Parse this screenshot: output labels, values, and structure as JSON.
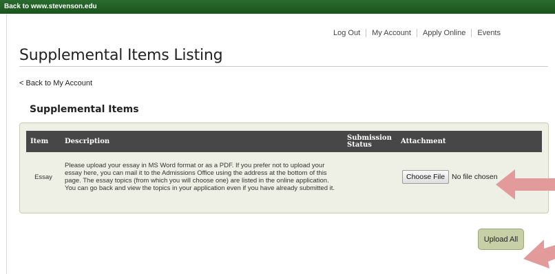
{
  "topbar": {
    "back_link": "Back to www.stevenson.edu"
  },
  "nav": {
    "logout": "Log Out",
    "my_account": "My Account",
    "apply_online": "Apply Online",
    "events": "Events"
  },
  "page": {
    "title": "Supplemental Items Listing",
    "back_link": "< Back to My Account",
    "section_title": "Supplemental Items"
  },
  "table": {
    "headers": {
      "item": "Item",
      "description": "Description",
      "status": "Submission Status",
      "attachment": "Attachment"
    },
    "rows": [
      {
        "item": "Essay",
        "description": "Please upload your essay in MS Word format or as a PDF. If you prefer not to upload your essay here, you can mail it to the Admissions Office using the address at the bottom of this page. The essay topics (from which you will choose one) are listed in the online application. You can go back and view the topics in your application even if you have already submitted it.",
        "status": "",
        "choose_file_label": "Choose File",
        "file_status": "No file chosen"
      }
    ]
  },
  "upload_button": {
    "label": "Upload All"
  },
  "colors": {
    "topbar": "#1b5e20",
    "table_header": "#474747",
    "panel_bg": "#eef0e6",
    "button_bg": "#c6cfa5",
    "annotation_arrow": "#e39a9a"
  }
}
